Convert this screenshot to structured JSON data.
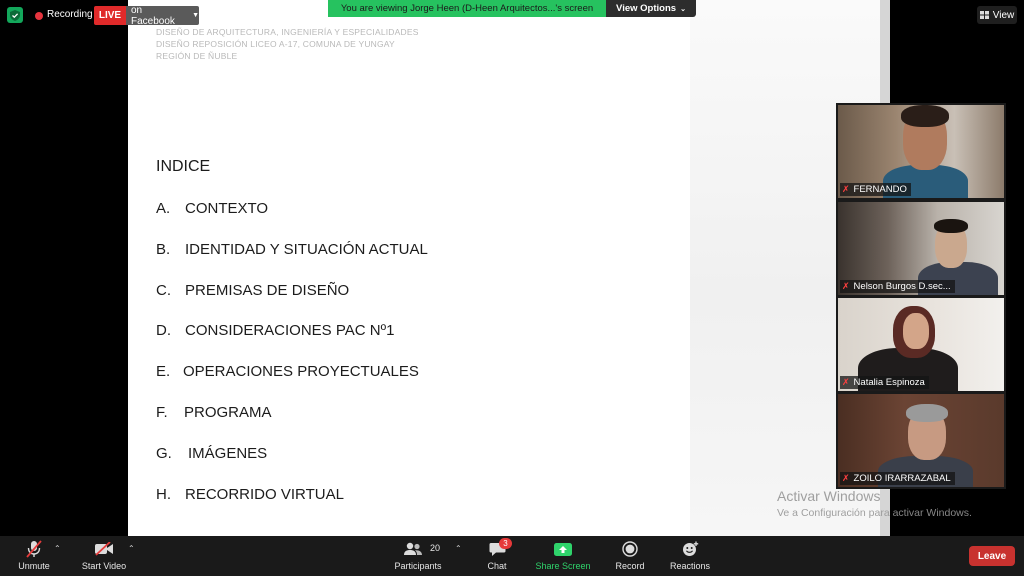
{
  "top_bar": {
    "recording_label": "Recording",
    "live_label": "LIVE",
    "facebook_label": "on Facebook",
    "viewing_banner": "You are viewing Jorge Heen (D-Heen Arquitectos...'s screen",
    "view_options_label": "View Options",
    "view_label": "View"
  },
  "slide": {
    "header_lines": [
      "DISEÑO DE ARQUITECTURA, INGENIERÍA Y ESPECIALIDADES",
      "DISEÑO REPOSICIÓN LICEO A-17, COMUNA DE YUNGAY",
      "REGIÓN DE ÑUBLE"
    ],
    "title": "INDICE",
    "items": [
      {
        "letter": "A.",
        "text": "CONTEXTO"
      },
      {
        "letter": "B.",
        "text": "IDENTIDAD Y SITUACIÓN ACTUAL"
      },
      {
        "letter": "C.",
        "text": "PREMISAS DE DISEÑO"
      },
      {
        "letter": "D.",
        "text": "CONSIDERACIONES PAC Nº1"
      },
      {
        "letter": "E.",
        "text": "OPERACIONES PROYECTUALES"
      },
      {
        "letter": "F.",
        "text": "PROGRAMA"
      },
      {
        "letter": "G.",
        "text": "IMÁGENES"
      },
      {
        "letter": "H.",
        "text": "RECORRIDO VIRTUAL"
      }
    ]
  },
  "participants": [
    {
      "name": "FERNANDO",
      "muted": true
    },
    {
      "name": "Nelson Burgos D.sec...",
      "muted": true
    },
    {
      "name": "Natalia Espinoza",
      "muted": true
    },
    {
      "name": "ZOILO IRARRAZABAL",
      "muted": true
    }
  ],
  "watermark": {
    "title": "Activar Windows",
    "subtitle": "Ve a Configuración para activar Windows."
  },
  "toolbar": {
    "unmute_label": "Unmute",
    "start_video_label": "Start Video",
    "participants_label": "Participants",
    "participants_count": "20",
    "chat_label": "Chat",
    "chat_badge": "3",
    "share_screen_label": "Share Screen",
    "record_label": "Record",
    "reactions_label": "Reactions",
    "leave_label": "Leave"
  },
  "colors": {
    "share_green": "#2fd36b",
    "banner_green": "#26c25f",
    "live_red": "#e02a2a",
    "leave_red": "#c8322f"
  }
}
